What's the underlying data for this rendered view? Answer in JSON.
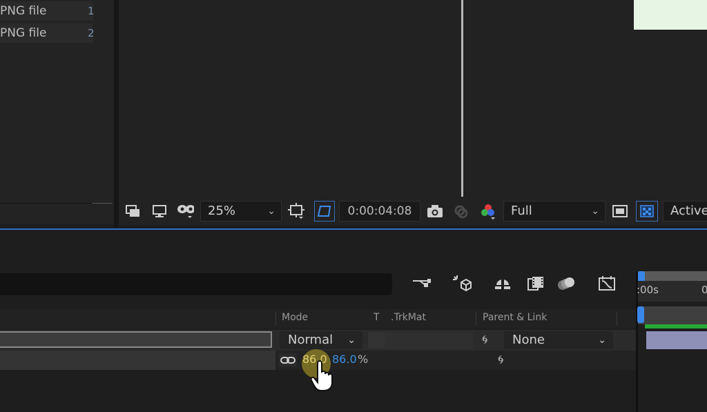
{
  "project": {
    "files": [
      {
        "label": "PNG file",
        "num": "1"
      },
      {
        "label": "PNG file",
        "num": "2"
      }
    ]
  },
  "viewer_toolbar": {
    "zoom": "25%",
    "timecode": "0:00:04:08",
    "resolution": "Full",
    "camera": "Active"
  },
  "timeline": {
    "columns": {
      "mode": "Mode",
      "t": "T",
      "trkmat": ".TrkMat",
      "parent": "Parent & Link"
    },
    "layer": {
      "mode": "Normal",
      "parent": "None"
    },
    "scale": {
      "x": "86.0",
      "y": "86.0",
      "unit": "%"
    },
    "ruler": {
      "start": ":00s",
      "tick": "0"
    }
  },
  "colors": {
    "accent_blue": "#2f6fcf",
    "playhead": "#3a86e8",
    "layer_bar": "#8f90b8",
    "green_bar": "#28a836",
    "value_yellow": "#e0d070",
    "value_blue": "#3a90e0"
  },
  "icons": [
    "comp-flowchart-icon",
    "monitor-icon",
    "mask-icon",
    "region-of-interest-icon",
    "transparency-grid-icon",
    "snapshot-icon",
    "show-snapshot-icon",
    "channel-icon",
    "fast-preview-icon",
    "toggle-transparency-icon",
    "shy-layer-icon",
    "draft-3d-icon",
    "frame-blending-icon",
    "motion-blur-icon",
    "graph-editor-icon",
    "link-icon",
    "pickwhip-icon",
    "hand-cursor-icon"
  ]
}
